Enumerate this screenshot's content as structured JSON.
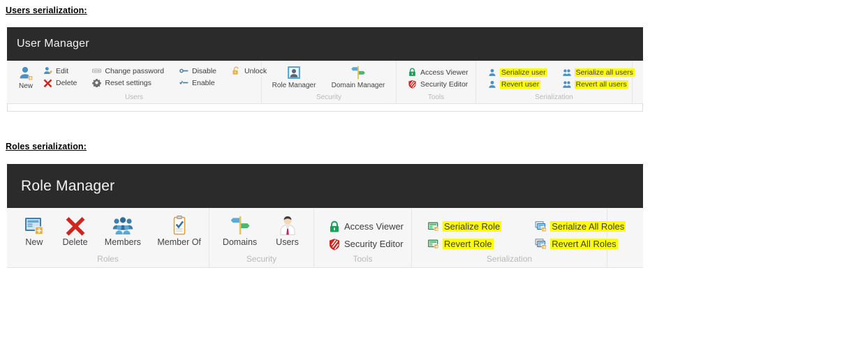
{
  "captions": {
    "users": "Users serialization:",
    "roles": "Roles serialization:"
  },
  "colors": {
    "titlebar_bg": "#2b2b2b",
    "ribbon_bg": "#f6f6f6",
    "highlight": "#ffff00",
    "group_title": "#b9b9b9",
    "label": "#3d3d3d",
    "icon_blue": "#4a90c4",
    "icon_red": "#d0251f",
    "icon_green": "#16a05a",
    "icon_gold": "#e8b04b"
  },
  "user_manager": {
    "title": "User Manager",
    "groups": [
      {
        "title": "Users",
        "big_buttons": [
          {
            "label": "New",
            "icon": "user-new-icon"
          }
        ],
        "small_columns": [
          [
            {
              "label": "Edit",
              "icon": "user-edit-icon",
              "highlighted": false
            },
            {
              "label": "Delete",
              "icon": "delete-x-icon",
              "highlighted": false
            }
          ],
          [
            {
              "label": "Change password",
              "icon": "password-icon",
              "highlighted": false
            },
            {
              "label": "Reset settings",
              "icon": "gear-icon",
              "highlighted": false
            }
          ],
          [
            {
              "label": "Disable",
              "icon": "disable-key-icon",
              "highlighted": false
            },
            {
              "label": "Enable",
              "icon": "enable-key-icon",
              "highlighted": false
            }
          ],
          [
            {
              "label": "Unlock",
              "icon": "unlock-icon",
              "highlighted": false
            }
          ]
        ]
      },
      {
        "title": "Security",
        "big_buttons": [
          {
            "label": "Role Manager",
            "icon": "role-manager-icon"
          },
          {
            "label": "Domain Manager",
            "icon": "domain-signpost-icon"
          }
        ],
        "small_columns": []
      },
      {
        "title": "Tools",
        "big_buttons": [],
        "small_columns": [
          [
            {
              "label": "Access Viewer",
              "icon": "green-lock-icon",
              "highlighted": false
            },
            {
              "label": "Security Editor",
              "icon": "red-shield-icon",
              "highlighted": false
            }
          ]
        ]
      },
      {
        "title": "Serialization",
        "big_buttons": [],
        "small_columns": [
          [
            {
              "label": "Serialize user",
              "icon": "single-user-icon",
              "highlighted": true
            },
            {
              "label": "Revert user",
              "icon": "single-user-icon",
              "highlighted": true
            }
          ],
          [
            {
              "label": "Serialize all users",
              "icon": "multi-user-icon",
              "highlighted": true
            },
            {
              "label": "Revert all users",
              "icon": "multi-user-icon",
              "highlighted": true
            }
          ]
        ]
      },
      {
        "title": "",
        "big_buttons": [],
        "small_columns": []
      }
    ]
  },
  "role_manager": {
    "title": "Role Manager",
    "groups": [
      {
        "title": "Roles",
        "big_buttons": [
          {
            "label": "New",
            "icon": "role-new-icon"
          },
          {
            "label": "Delete",
            "icon": "delete-x-icon"
          },
          {
            "label": "Members",
            "icon": "members-group-icon"
          },
          {
            "label": "Member Of",
            "icon": "member-of-clipboard-icon"
          }
        ],
        "small_columns": []
      },
      {
        "title": "Security",
        "big_buttons": [
          {
            "label": "Domains",
            "icon": "domain-signpost-icon"
          },
          {
            "label": "Users",
            "icon": "user-person-icon"
          }
        ],
        "small_columns": []
      },
      {
        "title": "Tools",
        "big_buttons": [],
        "small_columns": [
          [
            {
              "label": "Access Viewer",
              "icon": "green-lock-icon",
              "highlighted": false
            },
            {
              "label": "Security Editor",
              "icon": "red-shield-icon",
              "highlighted": false
            }
          ]
        ]
      },
      {
        "title": "Serialization",
        "big_buttons": [],
        "small_columns": [
          [
            {
              "label": "Serialize Role",
              "icon": "serialize-role-icon",
              "highlighted": true
            },
            {
              "label": "Revert Role",
              "icon": "serialize-role-icon",
              "highlighted": true
            }
          ],
          [
            {
              "label": "Serialize All Roles",
              "icon": "serialize-all-roles-icon",
              "highlighted": true
            },
            {
              "label": "Revert All Roles",
              "icon": "serialize-all-roles-icon",
              "highlighted": true
            }
          ]
        ]
      },
      {
        "title": "",
        "big_buttons": [],
        "small_columns": []
      }
    ]
  }
}
